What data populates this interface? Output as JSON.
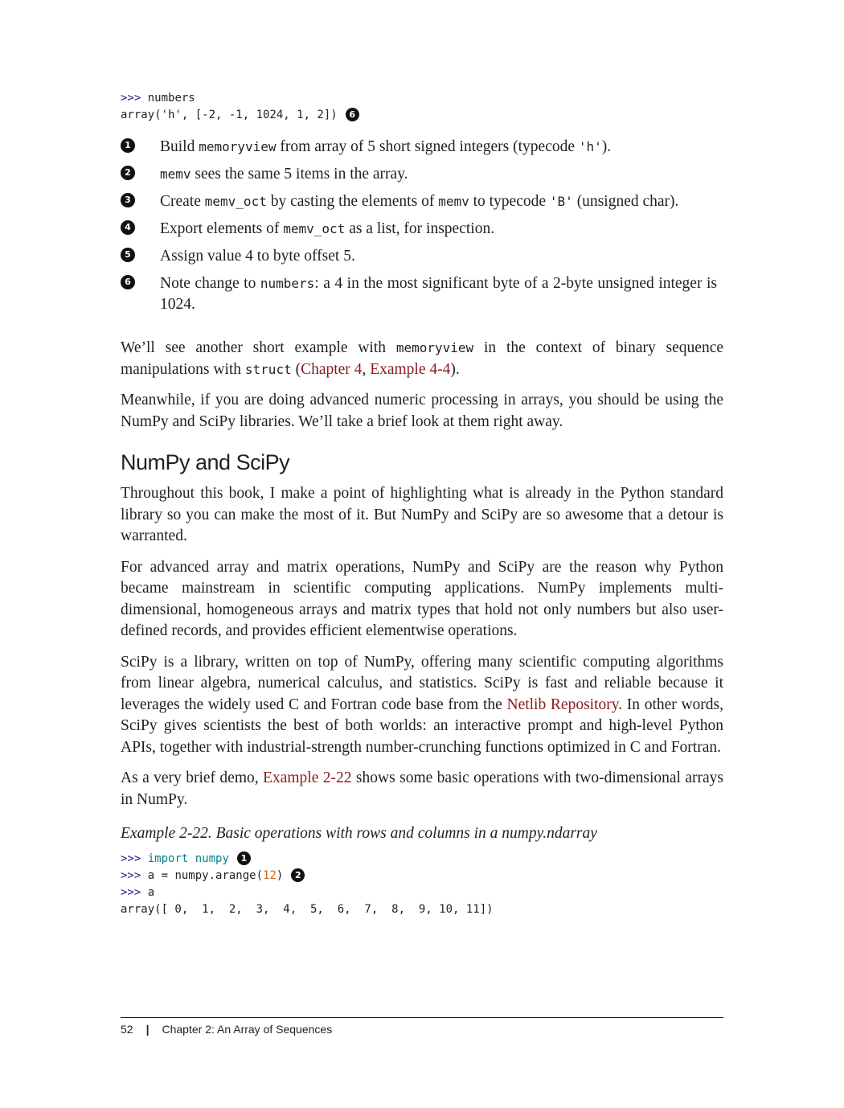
{
  "top_code": {
    "line1_prompt": ">>>",
    "line1_text": " numbers",
    "line2_text": "array('h', [-2, -1, 1024, 1, 2])",
    "line2_callout": "6"
  },
  "notes": [
    {
      "marker": "1",
      "parts": [
        "Build ",
        "memoryview",
        " from array of 5 short signed integers (typecode ",
        "'h'",
        ")."
      ]
    },
    {
      "marker": "2",
      "parts": [
        "",
        "memv",
        " sees the same 5 items in the array."
      ]
    },
    {
      "marker": "3",
      "parts": [
        "Create ",
        "memv_oct",
        " by casting the elements of ",
        "memv",
        " to typecode ",
        "'B'",
        " (unsigned char)."
      ]
    },
    {
      "marker": "4",
      "parts": [
        "Export elements of ",
        "memv_oct",
        " as a list, for inspection."
      ]
    },
    {
      "marker": "5",
      "parts": [
        "Assign value 4 to byte offset 5."
      ]
    },
    {
      "marker": "6",
      "parts": [
        "Note change to ",
        "numbers",
        ": a 4 in the most significant byte of a 2-byte unsigned integer is 1024."
      ]
    }
  ],
  "para1": {
    "t1": "We’ll see another short example with ",
    "c1": "memoryview",
    "t2": " in the context of binary sequence manipulations with ",
    "c2": "struct",
    "t3": " (",
    "l1": "Chapter 4",
    "t4": ", ",
    "l2": "Example 4-4",
    "t5": ")."
  },
  "para2": "Meanwhile, if you are doing advanced numeric processing in arrays, you should be using the NumPy and SciPy libraries. We’ll take a brief look at them right away.",
  "heading": "NumPy and SciPy",
  "para3": "Throughout this book, I make a point of highlighting what is already in the Python standard library so you can make the most of it. But NumPy and SciPy are so awesome that a detour is warranted.",
  "para4": "For advanced array and matrix operations, NumPy and SciPy are the reason why Python became mainstream in scientific computing applications. NumPy implements multi-dimensional, homogeneous arrays and matrix types that hold not only numbers but also user-defined records, and provides efficient elementwise operations.",
  "para5": {
    "t1": "SciPy is a library, written on top of NumPy, offering many scientific computing algorithms from linear algebra, numerical calculus, and statistics. SciPy is fast and reliable because it leverages the widely used C and Fortran code base from the ",
    "l1": "Netlib Repository",
    "t2": ". In other words, SciPy gives scientists the best of both worlds: an interactive prompt and high-level Python APIs, together with industrial-strength number-crunching functions optimized in C and Fortran."
  },
  "para6": {
    "t1": "As a very brief demo, ",
    "l1": "Example 2-22",
    "t2": " shows some basic operations with two-dimensional arrays in NumPy."
  },
  "caption": "Example 2-22. Basic operations with rows and columns in a numpy.ndarray",
  "bottom_code": {
    "prompt": ">>>",
    "l1_kw1": "import",
    "l1_kw2": "numpy",
    "l1_callout": "1",
    "l2_a": " a = numpy.arange(",
    "l2_num": "12",
    "l2_b": ")",
    "l2_callout": "2",
    "l3": " a",
    "l4": "array([ 0,  1,  2,  3,  4,  5,  6,  7,  8,  9, 10, 11])"
  },
  "footer": {
    "page_number": "52",
    "separator": "|",
    "chapter": "Chapter 2: An Array of Sequences"
  }
}
